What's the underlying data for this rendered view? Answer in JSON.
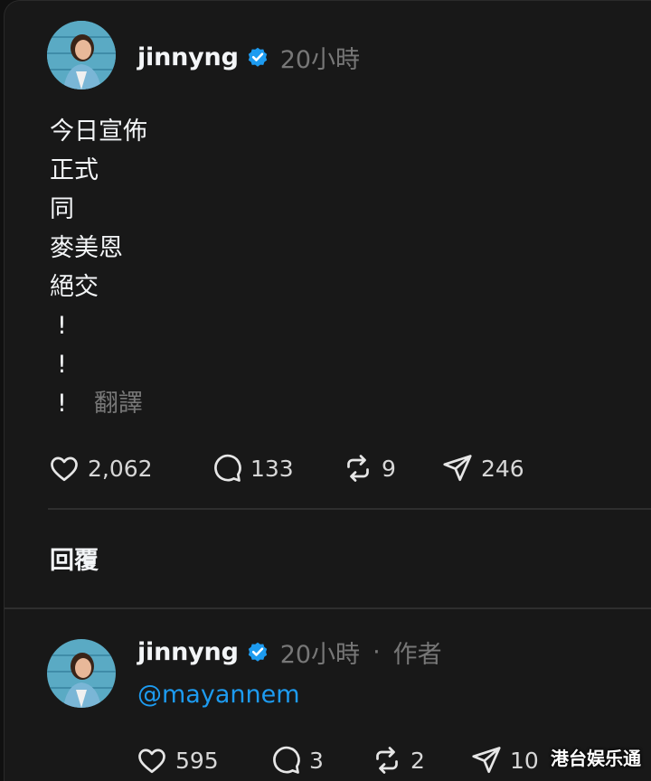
{
  "post": {
    "username": "jinnyng",
    "time": "20小時",
    "lines": [
      "今日宣佈",
      "正式",
      "同",
      "麥美恩",
      "絕交",
      "!",
      "!",
      "!"
    ],
    "translate_label": "翻譯",
    "stats": {
      "likes": "2,062",
      "comments": "133",
      "reposts": "9",
      "shares": "246"
    }
  },
  "replies_label": "回覆",
  "reply": {
    "username": "jinnyng",
    "time": "20小時",
    "separator": "·",
    "author_badge": "作者",
    "mention": "@mayannem",
    "stats": {
      "likes": "595",
      "comments": "3",
      "reposts": "2",
      "shares": "10"
    }
  },
  "watermark": "港台娱乐通",
  "colors": {
    "background": "#181818",
    "text": "#f3f5f7",
    "muted": "#777777",
    "verified": "#1d9bf0",
    "mention": "#1d9bf0"
  },
  "icons": {
    "verified": "verified-badge-icon",
    "like": "heart-icon",
    "comment": "comment-bubble-icon",
    "repost": "repost-icon",
    "share": "send-icon"
  }
}
